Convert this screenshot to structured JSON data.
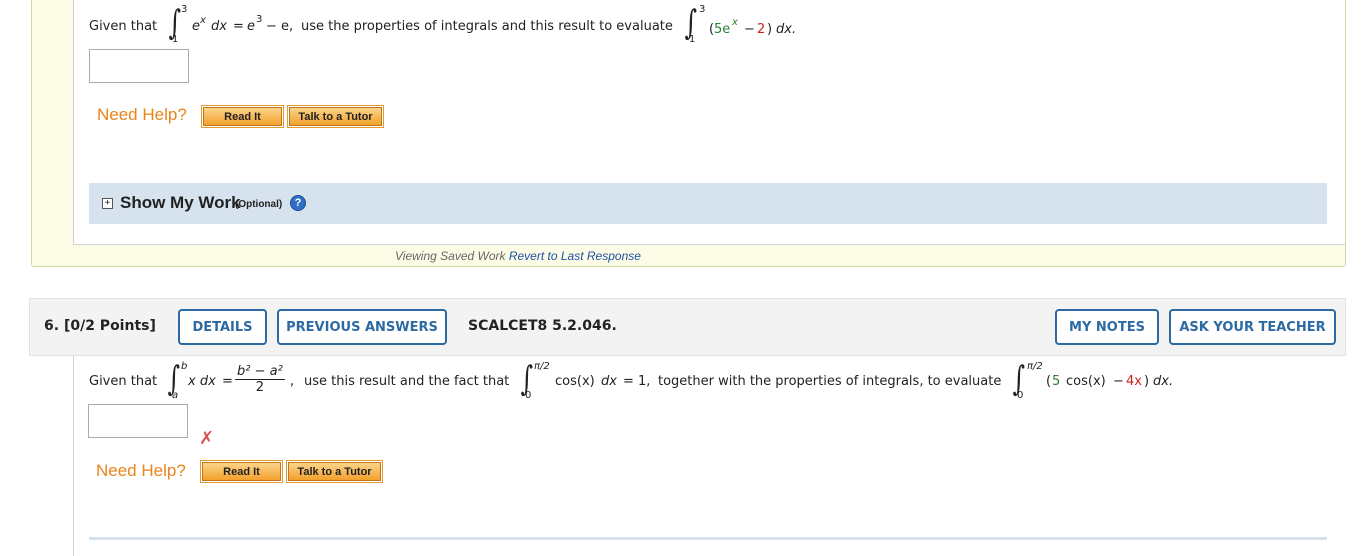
{
  "q5": {
    "given_label": "Given that",
    "integral1": {
      "upper": "3",
      "lower": "1",
      "integrand": "e",
      "integrand_sup": "x",
      "dx": "dx",
      "eq": "=",
      "rhs_e": "e",
      "rhs_sup": "3",
      "rhs_rest": "− e,",
      "rhs_last": "e"
    },
    "instruction": "use the properties of integrals and this result to evaluate",
    "integral2": {
      "upper": "3",
      "lower": "1",
      "open": "(",
      "coef": "5e",
      "coef_sup": "x",
      "minus": "−",
      "const": "2",
      "close": ")",
      "dx": "dx."
    },
    "answer_value": "",
    "need_help": "Need Help?",
    "read_it": "Read It",
    "talk_tutor": "Talk to a Tutor",
    "show_work_title": "Show My Work",
    "show_work_optional": "(Optional)",
    "help_icon": "?",
    "plus_icon": "+",
    "saved_label": "Viewing Saved Work",
    "revert_link": "Revert to Last Response"
  },
  "q6": {
    "number": "6.",
    "points": "[0/2 Points]",
    "details": "DETAILS",
    "previous_answers": "PREVIOUS ANSWERS",
    "code": "SCALCET8 5.2.046.",
    "my_notes": "MY NOTES",
    "ask_teacher": "ASK YOUR TEACHER",
    "given_label": "Given that",
    "integral1": {
      "upper": "b",
      "lower": "a",
      "integrand": "x dx",
      "eq": "=",
      "num": "b² − a²",
      "den": "2",
      "comma": ","
    },
    "instruction1": "use this result and the fact that",
    "integral2": {
      "upper": "π/2",
      "lower": "0",
      "body": "cos(x) dx = 1,",
      "cos_part": "cos(x)",
      "dx_part": "dx",
      "eq_part": "= 1,"
    },
    "instruction2": "together with the properties of integrals, to evaluate",
    "integral3": {
      "upper": "π/2",
      "lower": "0",
      "open": "(",
      "coef": "5",
      "cos": "cos(x)",
      "minus": "−",
      "term": "4x",
      "close": ")",
      "dx": "dx."
    },
    "answer_value": "",
    "status_icon": "✗",
    "need_help": "Need Help?",
    "read_it": "Read It",
    "talk_tutor": "Talk to a Tutor"
  },
  "colors": {
    "accent": "#2d6aa3",
    "help": "#e8841a",
    "wrong": "#d9534f",
    "red_term": "#cc2222",
    "green_term": "#2e7d32"
  }
}
